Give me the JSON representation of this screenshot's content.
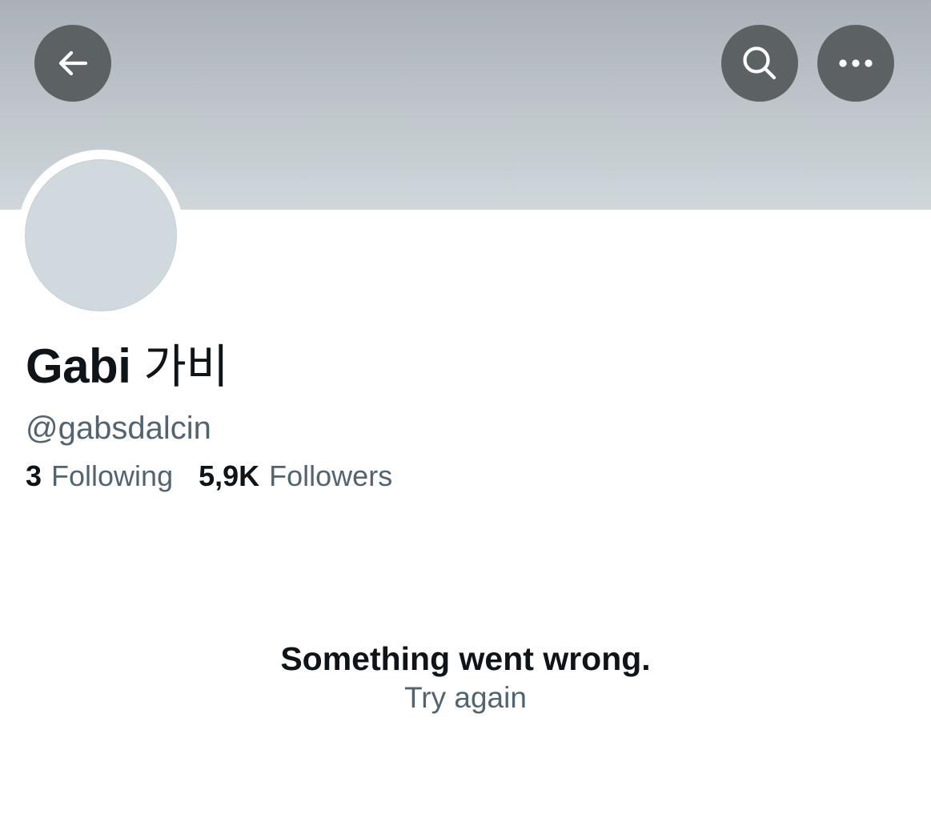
{
  "header": {
    "back_icon": "arrow-left-icon",
    "search_icon": "search-icon",
    "more_icon": "more-horizontal-icon",
    "button_color": "#5c6164",
    "banner_color": "#c0c7cc"
  },
  "profile": {
    "display_name_latin": "Gabi",
    "display_name_hangul": "가비",
    "handle": "@gabsdalcin",
    "avatar_color": "#d0d9de"
  },
  "stats": {
    "following_count": "3",
    "following_label": "Following",
    "followers_count": "5,9K",
    "followers_label": "Followers"
  },
  "error": {
    "message": "Something went wrong.",
    "retry_label": "Try again"
  }
}
